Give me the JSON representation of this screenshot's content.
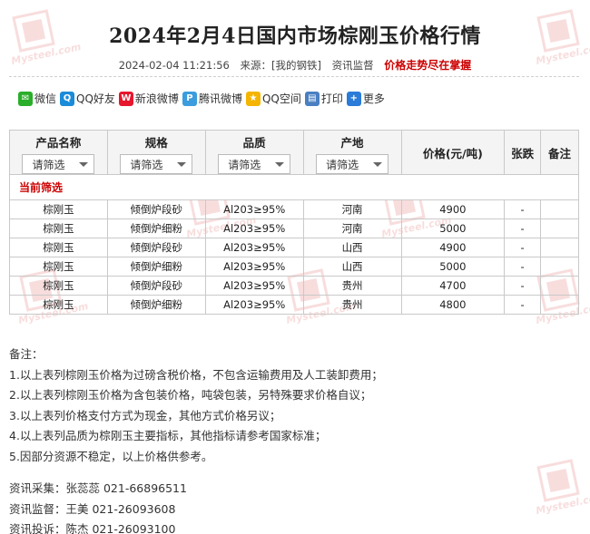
{
  "header": {
    "title": "2024年2月4日国内市场棕刚玉价格行情",
    "datetime": "2024-02-04 11:21:56",
    "source_label": "来源：",
    "source_name": "[我的钢铁]",
    "supervision": "资讯监督",
    "slogan": "价格走势尽在掌握"
  },
  "share": {
    "items": [
      {
        "label": "微信",
        "icon": "wechat-icon",
        "color": "#2aae2a",
        "glyph": "✉"
      },
      {
        "label": "QQ好友",
        "icon": "qq-icon",
        "color": "#1a8bd8",
        "glyph": "Q"
      },
      {
        "label": "新浪微博",
        "icon": "weibo-icon",
        "color": "#e6162d",
        "glyph": "W"
      },
      {
        "label": "腾讯微博",
        "icon": "tencent-weibo-icon",
        "color": "#3b9ddd",
        "glyph": "P"
      },
      {
        "label": "QQ空间",
        "icon": "qzone-icon",
        "color": "#f4b400",
        "glyph": "★"
      },
      {
        "label": "打印",
        "icon": "print-icon",
        "color": "#4a7fc1",
        "glyph": "▤"
      },
      {
        "label": "更多",
        "icon": "more-icon",
        "color": "#2b7bd8",
        "glyph": "+"
      }
    ]
  },
  "table": {
    "columns": [
      "产品名称",
      "规格",
      "品质",
      "产地",
      "价格(元/吨)",
      "张跌",
      "备注"
    ],
    "filter_placeholder": "请筛选",
    "current_filter_label": "当前筛选",
    "rows": [
      [
        "棕刚玉",
        "倾倒炉段砂",
        "Al203≥95%",
        "河南",
        "4900",
        "-",
        ""
      ],
      [
        "棕刚玉",
        "倾倒炉细粉",
        "Al203≥95%",
        "河南",
        "5000",
        "-",
        ""
      ],
      [
        "棕刚玉",
        "倾倒炉段砂",
        "Al203≥95%",
        "山西",
        "4900",
        "-",
        ""
      ],
      [
        "棕刚玉",
        "倾倒炉细粉",
        "Al203≥95%",
        "山西",
        "5000",
        "-",
        ""
      ],
      [
        "棕刚玉",
        "倾倒炉段砂",
        "Al203≥95%",
        "贵州",
        "4700",
        "-",
        ""
      ],
      [
        "棕刚玉",
        "倾倒炉细粉",
        "Al203≥95%",
        "贵州",
        "4800",
        "-",
        ""
      ]
    ]
  },
  "notes": {
    "heading": "备注：",
    "items": [
      "1.以上表列棕刚玉价格为过磅含税价格，不包含运输费用及人工装卸费用；",
      "2.以上表列棕刚玉价格为含包装价格，吨袋包装，另特殊要求价格自议；",
      "3.以上表列价格支付方式为现金，其他方式价格另议；",
      "4.以上表列品质为棕刚玉主要指标，其他指标请参考国家标准；",
      "5.因部分资源不稳定，以上价格供参考。"
    ]
  },
  "contacts": [
    "资讯采集：张蕊蕊  021-66896511",
    "资讯监督：王美  021-26093608",
    "资讯投诉：陈杰  021-26093100"
  ],
  "watermark": {
    "text": "Mysteel.com",
    "color": "#cc0000"
  }
}
